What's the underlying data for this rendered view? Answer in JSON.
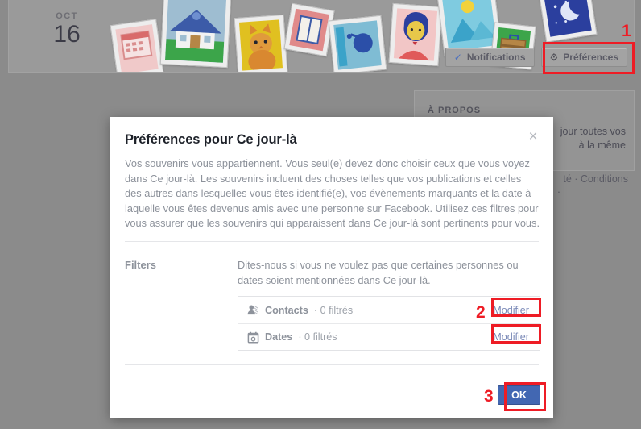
{
  "hero": {
    "date_month": "OCT",
    "date_day": "16",
    "buttons": [
      {
        "label": "Notifications",
        "icon": "check-icon"
      },
      {
        "label": "Préférences",
        "icon": "gear-icon"
      }
    ]
  },
  "about": {
    "title": "À PROPOS",
    "text_line1": "jour toutes vos",
    "text_line2": "à la même",
    "footer": "té · Conditions",
    "footer2": "·"
  },
  "modal": {
    "title": "Préférences pour Ce jour-là",
    "close_label": "×",
    "description": "Vos souvenirs vous appartiennent. Vous seul(e) devez donc choisir ceux que vous voyez dans Ce jour-là. Les souvenirs incluent des choses telles que vos publications et celles des autres dans lesquelles vous êtes identifié(e), vos évènements marquants et la date à laquelle vous êtes devenus amis avec une personne sur Facebook. Utilisez ces filtres pour vous assurer que les souvenirs qui apparaissent dans Ce jour-là sont pertinents pour vous.",
    "filters_label": "Filters",
    "filters_description": "Dites-nous si vous ne voulez pas que certaines personnes ou dates soient mentionnées dans Ce jour-là.",
    "filter_rows": [
      {
        "icon": "people-icon",
        "name": "Contacts",
        "count": "· 0 filtrés",
        "action": "Modifier"
      },
      {
        "icon": "calendar-icon",
        "name": "Dates",
        "count": "· 0 filtrés",
        "action": "Modifier"
      }
    ],
    "ok_label": "OK"
  },
  "annotations": {
    "marker1": "1",
    "marker2": "2",
    "marker3": "3",
    "color": "#ee1c25"
  },
  "colors": {
    "accent_blue": "#4267b2",
    "link_blue": "#7b8ab8",
    "muted_text": "#8d929b",
    "page_backdrop": "#8b8b8b"
  }
}
